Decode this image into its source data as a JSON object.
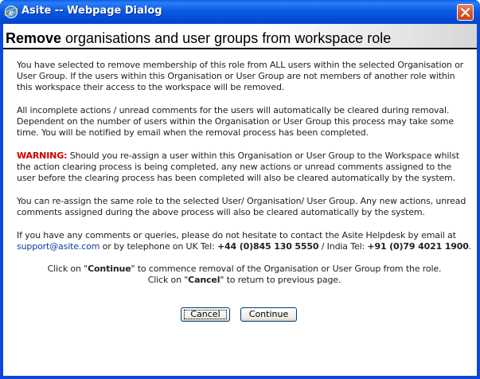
{
  "window": {
    "title": "Asite -- Webpage Dialog",
    "icon": "ie-icon",
    "close_icon": "close-icon"
  },
  "header": {
    "title_bold": "Remove",
    "title_rest": " organisations and user groups from workspace role"
  },
  "paragraphs": {
    "p1": "You have selected to remove membership of this role from ALL users within the selected Organisation or User Group. If the users within this Organisation or User Group are not members of another role within this workspace their access to the workspace will be removed.",
    "p2": "All incomplete actions / unread comments for the users will automatically be cleared during removal. Dependent on the number of users within the Organisation or User Group this process may take some time. You will be notified by email when the removal process has been completed.",
    "warning_label": "WARNING:",
    "warning_text": " Should you re-assign a user within this Organisation or User Group to the Workspace whilst the action clearing process is being completed, any new actions or unread comments assigned to the user before the clearing process has been completed will also be cleared automatically by the system.",
    "p4": "You can re-assign the same role to the selected User/ Organisation/ User Group. Any new actions, unread comments assigned during the above process will also be cleared automatically by the system.",
    "contact_intro": "If you have any comments or queries, please do not hesitate to contact the Asite Helpdesk by email at",
    "support_email": "support@asite.com",
    "contact_mid": " or by telephone on UK Tel: ",
    "uk_phone": "+44 (0)845 130 5550",
    "contact_sep": " / India Tel: ",
    "india_phone": "+91 (0)79 4021 1900",
    "contact_end": "."
  },
  "instructions": {
    "line1_pre": "Click on \"",
    "line1_keyword": "Continue",
    "line1_post": "\" to commence removal of the Organisation or User Group from the role.",
    "line2_pre": "Click on \"",
    "line2_keyword": "Cancel",
    "line2_post": "\" to return to previous page."
  },
  "buttons": {
    "cancel": "Cancel",
    "continue": "Continue"
  },
  "colors": {
    "titlebar": "#0a5fe8",
    "warning": "#d40000",
    "link": "#0b3aa8"
  }
}
